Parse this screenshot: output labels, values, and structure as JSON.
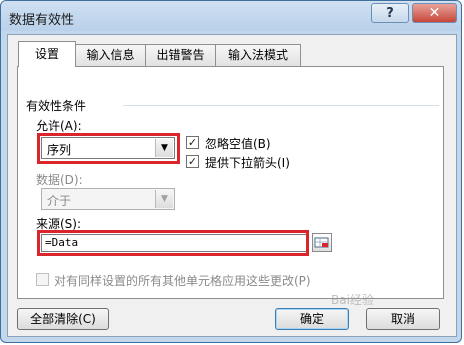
{
  "window": {
    "title": "数据有效性",
    "help_label": "?",
    "close_label": "✕"
  },
  "tabs": [
    {
      "label": "设置",
      "active": true
    },
    {
      "label": "输入信息",
      "active": false
    },
    {
      "label": "出错警告",
      "active": false
    },
    {
      "label": "输入法模式",
      "active": false
    }
  ],
  "settings": {
    "group_label": "有效性条件",
    "allow_label": "允许(A):",
    "allow_value": "序列",
    "ignore_blank_label": "忽略空值(B)",
    "ignore_blank_checked": true,
    "in_cell_dropdown_label": "提供下拉箭头(I)",
    "in_cell_dropdown_checked": true,
    "data_label": "数据(D):",
    "data_value": "介于",
    "source_label": "来源(S):",
    "source_value": "=Data",
    "apply_all_label": "对有同样设置的所有其他单元格应用这些更改(P)",
    "apply_all_checked": false
  },
  "buttons": {
    "clear_all": "全部清除(C)",
    "ok": "确定",
    "cancel": "取消"
  },
  "watermark": "Bai经验",
  "colors": {
    "highlight": "#d9252b",
    "titlebar": "#c3d7ec",
    "close": "#c7473a"
  }
}
